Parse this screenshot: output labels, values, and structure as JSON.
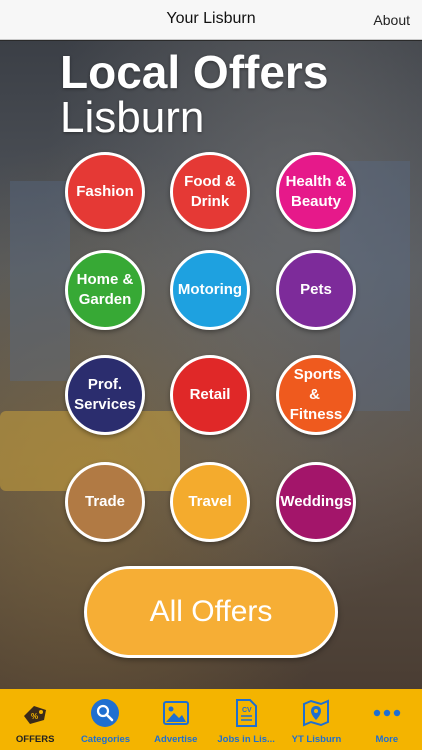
{
  "navbar": {
    "title": "Your Lisburn",
    "about": "About"
  },
  "headline": "Local Offers",
  "subhead": "Lisburn",
  "categories": [
    {
      "label1": "Fashion",
      "label2": "",
      "color": "#e53935"
    },
    {
      "label1": "Food &",
      "label2": "Drink",
      "color": "#e53935"
    },
    {
      "label1": "Health &",
      "label2": "Beauty",
      "color": "#e6198a"
    },
    {
      "label1": "Home &",
      "label2": "Garden",
      "color": "#37a935"
    },
    {
      "label1": "Motoring",
      "label2": "",
      "color": "#1ea1e0"
    },
    {
      "label1": "Pets",
      "label2": "",
      "color": "#7d2b9a"
    },
    {
      "label1": "Prof.",
      "label2": "Services",
      "color": "#2b2d6e"
    },
    {
      "label1": "Retail",
      "label2": "",
      "color": "#e02828"
    },
    {
      "label1": "Sports &",
      "label2": "Fitness",
      "color": "#ef5a1e"
    },
    {
      "label1": "Trade",
      "label2": "",
      "color": "#b17a44"
    },
    {
      "label1": "Travel",
      "label2": "",
      "color": "#f4ab2d"
    },
    {
      "label1": "Weddings",
      "label2": "",
      "color": "#a3156a"
    }
  ],
  "all_offers": "All Offers",
  "tabbar": [
    {
      "label": "OFFERS",
      "icon": "offers-tag-icon"
    },
    {
      "label": "Categories",
      "icon": "search-icon"
    },
    {
      "label": "Advertise",
      "icon": "image-icon"
    },
    {
      "label": "Jobs in Lis...",
      "icon": "cv-document-icon"
    },
    {
      "label": "YT Lisburn",
      "icon": "map-pin-icon"
    },
    {
      "label": "More",
      "icon": "more-dots-icon"
    }
  ]
}
